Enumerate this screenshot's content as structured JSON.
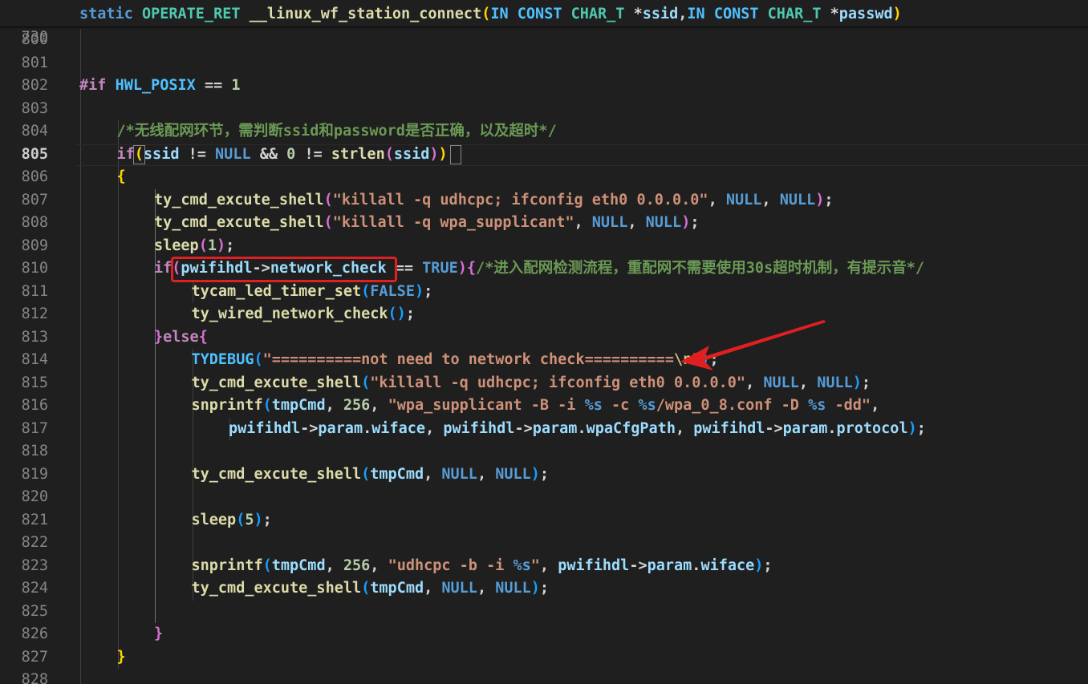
{
  "editor": {
    "sticky_line": {
      "number": "730",
      "tokens": [
        {
          "t": "static ",
          "c": "kw"
        },
        {
          "t": "OPERATE_RET ",
          "c": "ty"
        },
        {
          "t": "__linux_wf_station_connect",
          "c": "fn"
        },
        {
          "t": "(",
          "c": "b1"
        },
        {
          "t": "IN ",
          "c": "mac"
        },
        {
          "t": "CONST ",
          "c": "mac"
        },
        {
          "t": "CHAR_T ",
          "c": "ty"
        },
        {
          "t": "*",
          "c": "pn"
        },
        {
          "t": "ssid",
          "c": "vr"
        },
        {
          "t": ",",
          "c": "pn"
        },
        {
          "t": "IN ",
          "c": "mac"
        },
        {
          "t": "CONST ",
          "c": "mac"
        },
        {
          "t": "CHAR_T ",
          "c": "ty"
        },
        {
          "t": "*",
          "c": "pn"
        },
        {
          "t": "passwd",
          "c": "vr"
        },
        {
          "t": ")",
          "c": "b1"
        }
      ]
    },
    "active_line": "805",
    "lines": [
      {
        "number": "800",
        "indent": 0,
        "tokens": []
      },
      {
        "number": "801",
        "indent": 0,
        "tokens": []
      },
      {
        "number": "802",
        "indent": 0,
        "tokens": [
          {
            "t": "#if ",
            "c": "pp"
          },
          {
            "t": "HWL_POSIX",
            "c": "mac"
          },
          {
            "t": " == ",
            "c": "pn"
          },
          {
            "t": "1",
            "c": "num"
          }
        ]
      },
      {
        "number": "803",
        "indent": 0,
        "tokens": []
      },
      {
        "number": "804",
        "indent": 1,
        "tokens": [
          {
            "t": "/*无线配网环节，需判断ssid和password是否正确，以及超时*/",
            "c": "cm"
          }
        ]
      },
      {
        "number": "805",
        "indent": 1,
        "tokens": [
          {
            "t": "if",
            "c": "ctl"
          },
          {
            "t": "(",
            "c": "b1"
          },
          {
            "t": "ssid",
            "c": "vr"
          },
          {
            "t": " != ",
            "c": "pn"
          },
          {
            "t": "NULL",
            "c": "kw"
          },
          {
            "t": " && ",
            "c": "pn"
          },
          {
            "t": "0",
            "c": "num"
          },
          {
            "t": " != ",
            "c": "pn"
          },
          {
            "t": "strlen",
            "c": "fn"
          },
          {
            "t": "(",
            "c": "b2"
          },
          {
            "t": "ssid",
            "c": "vr"
          },
          {
            "t": ")",
            "c": "b2"
          },
          {
            "t": ")",
            "c": "b1"
          }
        ]
      },
      {
        "number": "806",
        "indent": 1,
        "tokens": [
          {
            "t": "{",
            "c": "b1"
          }
        ]
      },
      {
        "number": "807",
        "indent": 2,
        "tokens": [
          {
            "t": "ty_cmd_excute_shell",
            "c": "fn"
          },
          {
            "t": "(",
            "c": "b2"
          },
          {
            "t": "\"killall -q udhcpc; ifconfig eth0 0.0.0.0\"",
            "c": "st"
          },
          {
            "t": ", ",
            "c": "pn"
          },
          {
            "t": "NULL",
            "c": "kw"
          },
          {
            "t": ", ",
            "c": "pn"
          },
          {
            "t": "NULL",
            "c": "kw"
          },
          {
            "t": ")",
            "c": "b2"
          },
          {
            "t": ";",
            "c": "pn"
          }
        ]
      },
      {
        "number": "808",
        "indent": 2,
        "tokens": [
          {
            "t": "ty_cmd_excute_shell",
            "c": "fn"
          },
          {
            "t": "(",
            "c": "b2"
          },
          {
            "t": "\"killall -q wpa_supplicant\"",
            "c": "st"
          },
          {
            "t": ", ",
            "c": "pn"
          },
          {
            "t": "NULL",
            "c": "kw"
          },
          {
            "t": ", ",
            "c": "pn"
          },
          {
            "t": "NULL",
            "c": "kw"
          },
          {
            "t": ")",
            "c": "b2"
          },
          {
            "t": ";",
            "c": "pn"
          }
        ]
      },
      {
        "number": "809",
        "indent": 2,
        "tokens": [
          {
            "t": "sleep",
            "c": "fn"
          },
          {
            "t": "(",
            "c": "b2"
          },
          {
            "t": "1",
            "c": "num"
          },
          {
            "t": ")",
            "c": "b2"
          },
          {
            "t": ";",
            "c": "pn"
          }
        ]
      },
      {
        "number": "810",
        "indent": 2,
        "tokens": [
          {
            "t": "if",
            "c": "ctl"
          },
          {
            "t": "(",
            "c": "b2"
          },
          {
            "t": "pwifihdl",
            "c": "vr"
          },
          {
            "t": "->",
            "c": "pn"
          },
          {
            "t": "network_check",
            "c": "vr"
          },
          {
            "t": " == ",
            "c": "pn"
          },
          {
            "t": "TRUE",
            "c": "kw"
          },
          {
            "t": ")",
            "c": "b2"
          },
          {
            "t": "{",
            "c": "b2"
          },
          {
            "t": "/*进入配网检测流程，重配网不需要使用30s超时机制，有提示音*/",
            "c": "cm"
          }
        ]
      },
      {
        "number": "811",
        "indent": 3,
        "tokens": [
          {
            "t": "tycam_led_timer_set",
            "c": "fn"
          },
          {
            "t": "(",
            "c": "b3"
          },
          {
            "t": "FALSE",
            "c": "kw"
          },
          {
            "t": ")",
            "c": "b3"
          },
          {
            "t": ";",
            "c": "pn"
          }
        ]
      },
      {
        "number": "812",
        "indent": 3,
        "tokens": [
          {
            "t": "ty_wired_network_check",
            "c": "fn"
          },
          {
            "t": "(",
            "c": "b3"
          },
          {
            "t": ")",
            "c": "b3"
          },
          {
            "t": ";",
            "c": "pn"
          }
        ]
      },
      {
        "number": "813",
        "indent": 2,
        "tokens": [
          {
            "t": "}",
            "c": "b2"
          },
          {
            "t": "else",
            "c": "ctl"
          },
          {
            "t": "{",
            "c": "b2"
          }
        ]
      },
      {
        "number": "814",
        "indent": 3,
        "tokens": [
          {
            "t": "TYDEBUG",
            "c": "mac"
          },
          {
            "t": "(",
            "c": "b3"
          },
          {
            "t": "\"==========not need to network check==========",
            "c": "st"
          },
          {
            "t": "\\n",
            "c": "esc"
          },
          {
            "t": "\"",
            "c": "st"
          },
          {
            "t": ")",
            "c": "b3"
          },
          {
            "t": ";",
            "c": "pn"
          }
        ]
      },
      {
        "number": "815",
        "indent": 3,
        "tokens": [
          {
            "t": "ty_cmd_excute_shell",
            "c": "fn"
          },
          {
            "t": "(",
            "c": "b3"
          },
          {
            "t": "\"killall -q udhcpc; ifconfig eth0 0.0.0.0\"",
            "c": "st"
          },
          {
            "t": ", ",
            "c": "pn"
          },
          {
            "t": "NULL",
            "c": "kw"
          },
          {
            "t": ", ",
            "c": "pn"
          },
          {
            "t": "NULL",
            "c": "kw"
          },
          {
            "t": ")",
            "c": "b3"
          },
          {
            "t": ";",
            "c": "pn"
          }
        ]
      },
      {
        "number": "816",
        "indent": 3,
        "tokens": [
          {
            "t": "snprintf",
            "c": "fn"
          },
          {
            "t": "(",
            "c": "b3"
          },
          {
            "t": "tmpCmd",
            "c": "vr"
          },
          {
            "t": ", ",
            "c": "pn"
          },
          {
            "t": "256",
            "c": "num"
          },
          {
            "t": ", ",
            "c": "pn"
          },
          {
            "t": "\"wpa_supplicant -B -i ",
            "c": "st"
          },
          {
            "t": "%s",
            "c": "kw"
          },
          {
            "t": " -c ",
            "c": "st"
          },
          {
            "t": "%s",
            "c": "kw"
          },
          {
            "t": "/wpa_0_8.conf -D ",
            "c": "st"
          },
          {
            "t": "%s",
            "c": "kw"
          },
          {
            "t": " -dd\"",
            "c": "st"
          },
          {
            "t": ",",
            "c": "pn"
          }
        ]
      },
      {
        "number": "817",
        "indent": 4,
        "tokens": [
          {
            "t": "pwifihdl",
            "c": "vr"
          },
          {
            "t": "->",
            "c": "pn"
          },
          {
            "t": "param",
            "c": "vr"
          },
          {
            "t": ".",
            "c": "pn"
          },
          {
            "t": "wiface",
            "c": "vr"
          },
          {
            "t": ", ",
            "c": "pn"
          },
          {
            "t": "pwifihdl",
            "c": "vr"
          },
          {
            "t": "->",
            "c": "pn"
          },
          {
            "t": "param",
            "c": "vr"
          },
          {
            "t": ".",
            "c": "pn"
          },
          {
            "t": "wpaCfgPath",
            "c": "vr"
          },
          {
            "t": ", ",
            "c": "pn"
          },
          {
            "t": "pwifihdl",
            "c": "vr"
          },
          {
            "t": "->",
            "c": "pn"
          },
          {
            "t": "param",
            "c": "vr"
          },
          {
            "t": ".",
            "c": "pn"
          },
          {
            "t": "protocol",
            "c": "vr"
          },
          {
            "t": ")",
            "c": "b3"
          },
          {
            "t": ";",
            "c": "pn"
          }
        ]
      },
      {
        "number": "818",
        "indent": 0,
        "tokens": []
      },
      {
        "number": "819",
        "indent": 3,
        "tokens": [
          {
            "t": "ty_cmd_excute_shell",
            "c": "fn"
          },
          {
            "t": "(",
            "c": "b3"
          },
          {
            "t": "tmpCmd",
            "c": "vr"
          },
          {
            "t": ", ",
            "c": "pn"
          },
          {
            "t": "NULL",
            "c": "kw"
          },
          {
            "t": ", ",
            "c": "pn"
          },
          {
            "t": "NULL",
            "c": "kw"
          },
          {
            "t": ")",
            "c": "b3"
          },
          {
            "t": ";",
            "c": "pn"
          }
        ]
      },
      {
        "number": "820",
        "indent": 0,
        "tokens": []
      },
      {
        "number": "821",
        "indent": 3,
        "tokens": [
          {
            "t": "sleep",
            "c": "fn"
          },
          {
            "t": "(",
            "c": "b3"
          },
          {
            "t": "5",
            "c": "num"
          },
          {
            "t": ")",
            "c": "b3"
          },
          {
            "t": ";",
            "c": "pn"
          }
        ]
      },
      {
        "number": "822",
        "indent": 0,
        "tokens": []
      },
      {
        "number": "823",
        "indent": 3,
        "tokens": [
          {
            "t": "snprintf",
            "c": "fn"
          },
          {
            "t": "(",
            "c": "b3"
          },
          {
            "t": "tmpCmd",
            "c": "vr"
          },
          {
            "t": ", ",
            "c": "pn"
          },
          {
            "t": "256",
            "c": "num"
          },
          {
            "t": ", ",
            "c": "pn"
          },
          {
            "t": "\"udhcpc -b -i ",
            "c": "st"
          },
          {
            "t": "%s",
            "c": "kw"
          },
          {
            "t": "\"",
            "c": "st"
          },
          {
            "t": ", ",
            "c": "pn"
          },
          {
            "t": "pwifihdl",
            "c": "vr"
          },
          {
            "t": "->",
            "c": "pn"
          },
          {
            "t": "param",
            "c": "vr"
          },
          {
            "t": ".",
            "c": "pn"
          },
          {
            "t": "wiface",
            "c": "vr"
          },
          {
            "t": ")",
            "c": "b3"
          },
          {
            "t": ";",
            "c": "pn"
          }
        ]
      },
      {
        "number": "824",
        "indent": 3,
        "tokens": [
          {
            "t": "ty_cmd_excute_shell",
            "c": "fn"
          },
          {
            "t": "(",
            "c": "b3"
          },
          {
            "t": "tmpCmd",
            "c": "vr"
          },
          {
            "t": ", ",
            "c": "pn"
          },
          {
            "t": "NULL",
            "c": "kw"
          },
          {
            "t": ", ",
            "c": "pn"
          },
          {
            "t": "NULL",
            "c": "kw"
          },
          {
            "t": ")",
            "c": "b3"
          },
          {
            "t": ";",
            "c": "pn"
          }
        ]
      },
      {
        "number": "825",
        "indent": 0,
        "tokens": []
      },
      {
        "number": "826",
        "indent": 2,
        "tokens": [
          {
            "t": "}",
            "c": "b2"
          }
        ]
      },
      {
        "number": "827",
        "indent": 1,
        "tokens": [
          {
            "t": "}",
            "c": "b1"
          }
        ]
      },
      {
        "number": "828",
        "indent": 0,
        "tokens": []
      }
    ]
  },
  "annotations": {
    "highlight_box_color": "#e02020",
    "arrow_color": "#e02020"
  }
}
